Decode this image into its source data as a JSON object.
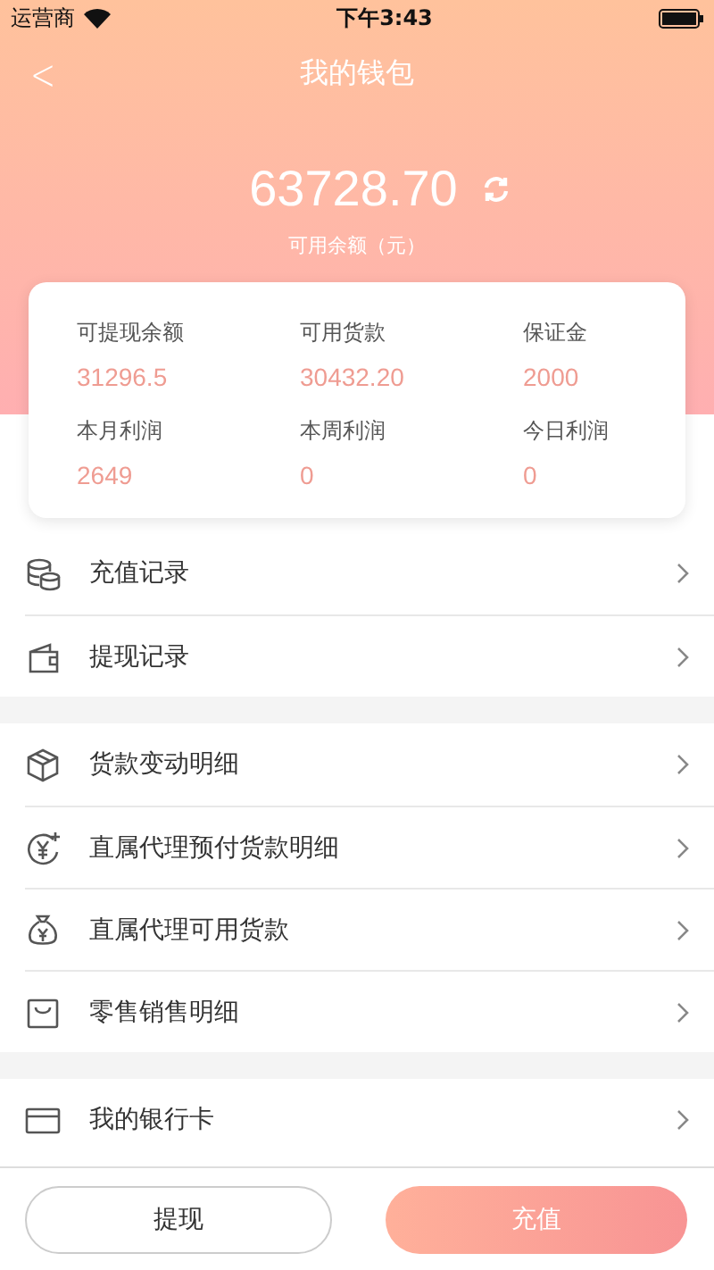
{
  "status_bar": {
    "carrier": "运营商",
    "time": "下午3:43"
  },
  "nav": {
    "back": "<",
    "title": "我的钱包"
  },
  "balance": {
    "amount": "63728.70",
    "label": "可用余额（元）"
  },
  "stats": [
    {
      "label": "可提现余额",
      "value": "31296.5"
    },
    {
      "label": "可用货款",
      "value": "30432.20"
    },
    {
      "label": "保证金",
      "value": "2000"
    },
    {
      "label": "本月利润",
      "value": "2649"
    },
    {
      "label": "本周利润",
      "value": "0"
    },
    {
      "label": "今日利润",
      "value": "0"
    }
  ],
  "menu_groups": [
    [
      {
        "kind": "coins",
        "label": "充值记录"
      },
      {
        "kind": "wallet",
        "label": "提现记录"
      }
    ],
    [
      {
        "kind": "box",
        "label": "货款变动明细"
      },
      {
        "kind": "yen-plus",
        "label": "直属代理预付货款明细"
      },
      {
        "kind": "moneybag",
        "label": "直属代理可用货款"
      },
      {
        "kind": "bag",
        "label": "零售销售明细"
      }
    ],
    [
      {
        "kind": "card",
        "label": "我的银行卡"
      }
    ]
  ],
  "buttons": [
    {
      "label": "提现",
      "kind": "outline"
    },
    {
      "label": "充值",
      "kind": "filled"
    }
  ]
}
